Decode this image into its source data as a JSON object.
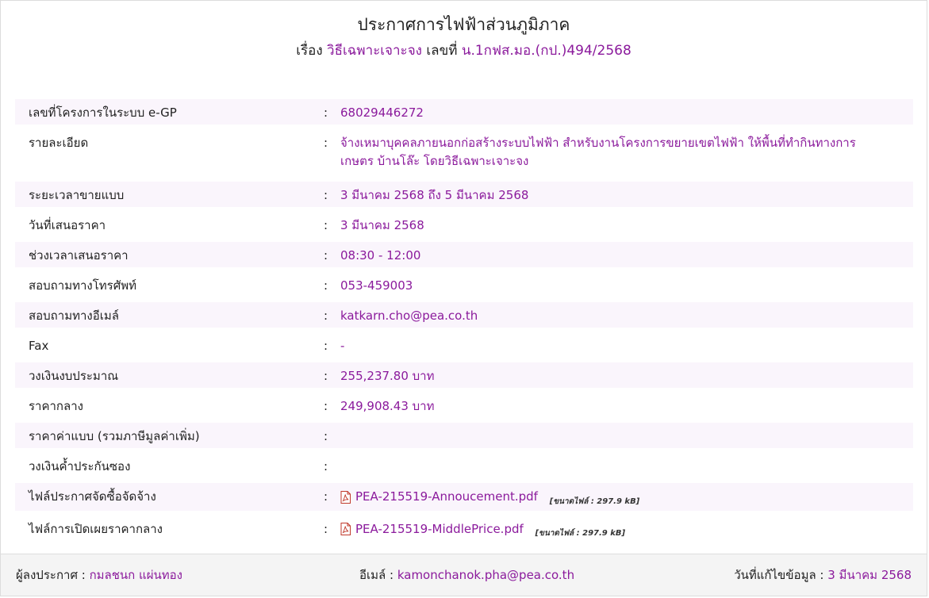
{
  "header": {
    "title": "ประกาศการไฟฟ้าส่วนภูมิภาค",
    "subject_label": "เรื่อง",
    "subject_value": "วิธีเฉพาะเจาะจง",
    "number_label": "เลขที่",
    "number_value": "น.1กฟส.มอ.(กป.)494/2568"
  },
  "details": {
    "colon": ":",
    "rows": [
      {
        "label": "เลขที่โครงการในระบบ e-GP",
        "value": "68029446272"
      },
      {
        "label": "รายละเอียด",
        "value": "จ้างเหมาบุคคลภายนอกก่อสร้างระบบไฟฟ้า สำหรับงานโครงการขยายเขตไฟฟ้า ให้พื้นที่ทำกินทางการเกษตร บ้านโล๊ะ โดยวิธีเฉพาะเจาะจง"
      },
      {
        "label": "ระยะเวลาขายแบบ",
        "value": "3 มีนาคม 2568 ถึง 5 มีนาคม 2568"
      },
      {
        "label": "วันที่เสนอราคา",
        "value": "3 มีนาคม 2568"
      },
      {
        "label": "ช่วงเวลาเสนอราคา",
        "value": "08:30 - 12:00"
      },
      {
        "label": "สอบถามทางโทรศัพท์",
        "value": "053-459003"
      },
      {
        "label": "สอบถามทางอีเมล์",
        "value": "katkarn.cho@pea.co.th"
      },
      {
        "label": "Fax",
        "value": "-"
      },
      {
        "label": "วงเงินงบประมาณ",
        "value": "255,237.80 บาท"
      },
      {
        "label": "ราคากลาง",
        "value": "249,908.43 บาท"
      },
      {
        "label": "ราคาค่าแบบ (รวมภาษีมูลค่าเพิ่ม)",
        "value": ""
      },
      {
        "label": "วงเงินค้ำประกันซอง",
        "value": ""
      },
      {
        "label": "ไฟล์ประกาศจัดซื้อจัดจ้าง",
        "file_name": "PEA-215519-Annoucement.pdf",
        "file_size": "[ขนาดไฟล์ : 297.9 kB]"
      },
      {
        "label": "ไฟล์การเปิดเผยราคากลาง",
        "file_name": "PEA-215519-MiddlePrice.pdf",
        "file_size": "[ขนาดไฟล์ : 297.9 kB]"
      }
    ]
  },
  "footer": {
    "announcer_label": "ผู้ลงประกาศ :",
    "announcer_value": "กมลชนก แผ่นทอง",
    "email_label": "อีเมล์ :",
    "email_value": "kamonchanok.pha@pea.co.th",
    "updated_label": "วันที่แก้ไขข้อมูล :",
    "updated_value": "3 มีนาคม 2568"
  },
  "colors": {
    "accent": "#8b1a9c",
    "row_alt": "#faf5fc",
    "pdf_icon": "#c0392b"
  },
  "icons": {
    "file": "pdf-file-icon"
  }
}
